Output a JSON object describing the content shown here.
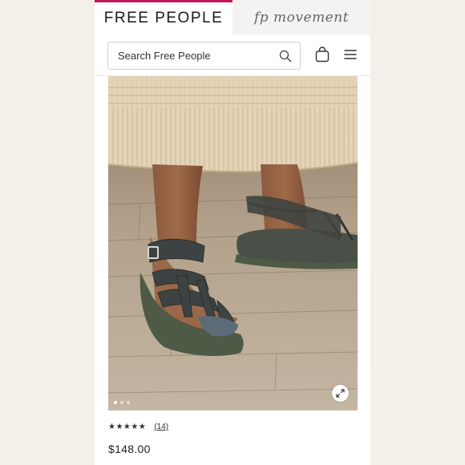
{
  "tabs": {
    "free_people": "FREE PEOPLE",
    "fp_movement": "fp movement"
  },
  "search": {
    "placeholder": "Search Free People"
  },
  "icons": {
    "search": "search-icon",
    "bag": "shopping-bag-icon",
    "menu": "hamburger-menu-icon",
    "zoom": "expand-icon"
  },
  "colors": {
    "active_tab_accent": "#c2185b",
    "inactive_tab_bg": "#f4f3f1"
  },
  "product": {
    "image_alt": "Dark grey leather fisherman sandals worn with a knit skirt on a wooden floor",
    "carousel": {
      "total": 3,
      "active_index": 1
    },
    "rating_stars": "★★★★★",
    "rating_value": 4.5,
    "review_count": "(14)",
    "price": "$148.00"
  }
}
